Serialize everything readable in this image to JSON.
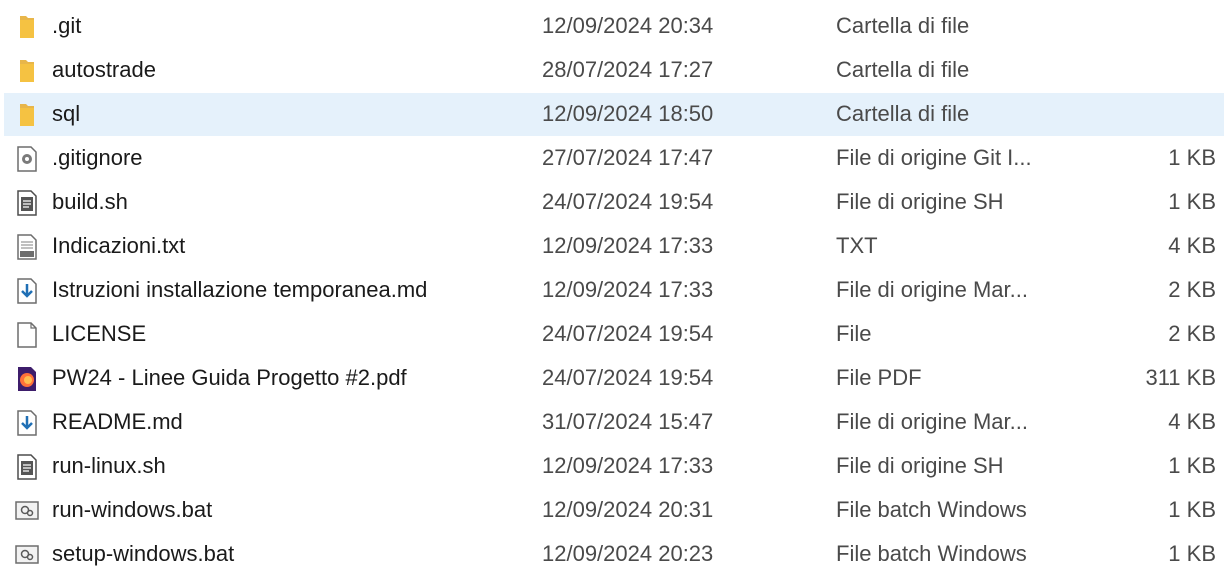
{
  "files": [
    {
      "name": ".git",
      "date": "12/09/2024 20:34",
      "type": "Cartella di file",
      "size": "",
      "icon": "folder-icon",
      "selected": false
    },
    {
      "name": "autostrade",
      "date": "28/07/2024 17:27",
      "type": "Cartella di file",
      "size": "",
      "icon": "folder-icon",
      "selected": false
    },
    {
      "name": "sql",
      "date": "12/09/2024 18:50",
      "type": "Cartella di file",
      "size": "",
      "icon": "folder-icon",
      "selected": true
    },
    {
      "name": ".gitignore",
      "date": "27/07/2024 17:47",
      "type": "File di origine Git I...",
      "size": "1 KB",
      "icon": "gear-file-icon",
      "selected": false
    },
    {
      "name": "build.sh",
      "date": "24/07/2024 19:54",
      "type": "File di origine SH",
      "size": "1 KB",
      "icon": "script-file-icon",
      "selected": false
    },
    {
      "name": "Indicazioni.txt",
      "date": "12/09/2024 17:33",
      "type": "TXT",
      "size": "4 KB",
      "icon": "text-file-icon",
      "selected": false
    },
    {
      "name": "Istruzioni installazione temporanea.md",
      "date": "12/09/2024 17:33",
      "type": "File di origine Mar...",
      "size": "2 KB",
      "icon": "markdown-file-icon",
      "selected": false
    },
    {
      "name": "LICENSE",
      "date": "24/07/2024 19:54",
      "type": "File",
      "size": "2 KB",
      "icon": "blank-file-icon",
      "selected": false
    },
    {
      "name": "PW24 - Linee Guida Progetto #2.pdf",
      "date": "24/07/2024 19:54",
      "type": "File PDF",
      "size": "311 KB",
      "icon": "firefox-pdf-icon",
      "selected": false
    },
    {
      "name": "README.md",
      "date": "31/07/2024 15:47",
      "type": "File di origine Mar...",
      "size": "4 KB",
      "icon": "markdown-file-icon",
      "selected": false
    },
    {
      "name": "run-linux.sh",
      "date": "12/09/2024 17:33",
      "type": "File di origine SH",
      "size": "1 KB",
      "icon": "script-file-icon",
      "selected": false
    },
    {
      "name": "run-windows.bat",
      "date": "12/09/2024 20:31",
      "type": "File batch Windows",
      "size": "1 KB",
      "icon": "batch-file-icon",
      "selected": false
    },
    {
      "name": "setup-windows.bat",
      "date": "12/09/2024 20:23",
      "type": "File batch Windows",
      "size": "1 KB",
      "icon": "batch-file-icon",
      "selected": false
    }
  ],
  "colors": {
    "folder": "#f5c242",
    "selection": "#e5f1fb",
    "markdown_arrow": "#1f6fb5"
  }
}
